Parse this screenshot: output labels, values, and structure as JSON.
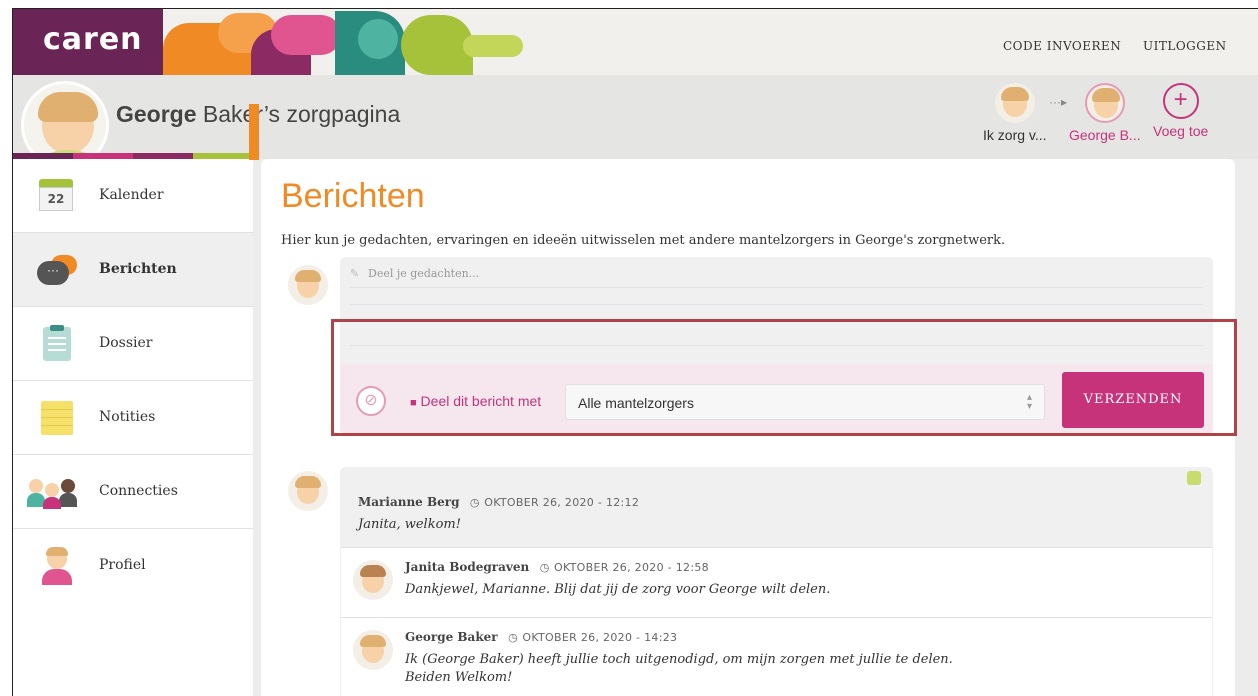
{
  "brand": {
    "logo": "caren"
  },
  "topnav": {
    "code": "CODE INVOEREN",
    "logout": "UITLOGGEN"
  },
  "header": {
    "name_bold": "George",
    "name_rest": " Baker’s zorgpagina",
    "switcher": [
      {
        "label": "Ik zorg v..."
      },
      {
        "label": "George B..."
      },
      {
        "label": "Voeg toe"
      }
    ]
  },
  "sidebar": {
    "items": [
      {
        "label": "Kalender",
        "badge": "22"
      },
      {
        "label": "Berichten"
      },
      {
        "label": "Dossier"
      },
      {
        "label": "Notities"
      },
      {
        "label": "Connecties"
      },
      {
        "label": "Profiel"
      }
    ]
  },
  "main": {
    "title": "Berichten",
    "intro": "Hier kun je gedachten, ervaringen en ideeën uitwisselen met andere mantelzorgers in George's zorgnetwerk.",
    "composer": {
      "placeholder": "Deel je gedachten...",
      "share_label": "Deel dit bericht met",
      "share_value": "Alle mantelzorgers",
      "send": "VERZENDEN"
    },
    "post": {
      "author": "Marianne Berg",
      "date": "OKTOBER 26, 2020 - 12:12",
      "text": "Janita, welkom!",
      "replies": [
        {
          "author": "Janita Bodegraven",
          "date": "OKTOBER 26, 2020 - 12:58",
          "text": "Dankjewel, Marianne. Blij dat jij de zorg voor George wilt delen."
        },
        {
          "author": "George Baker",
          "date": "OKTOBER 26, 2020 - 14:23",
          "text1": "Ik (George Baker) heeft jullie toch uitgenodigd, om mijn zorgen met jullie te delen.",
          "text2": "Beiden Welkom!"
        }
      ]
    }
  },
  "colors": {
    "accent_orange": "#f08a24",
    "accent_pink": "#c6337a",
    "brand_purple": "#6b2456",
    "highlight": "#b04348"
  }
}
